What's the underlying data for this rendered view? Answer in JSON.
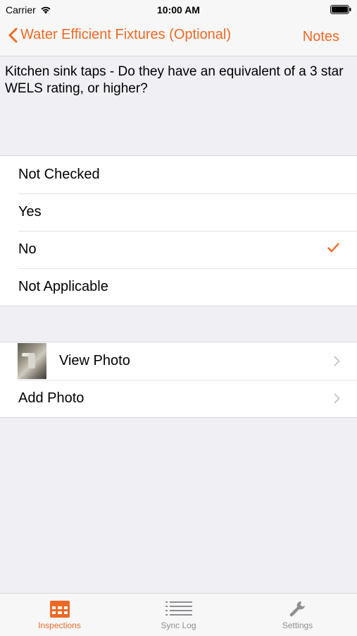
{
  "status_bar": {
    "carrier": "Carrier",
    "time": "10:00 AM"
  },
  "nav": {
    "back_label": "Water Efficient Fixtures (Optional)",
    "notes_label": "Notes"
  },
  "question": "Kitchen sink taps - Do they have an equivalent of a 3 star WELS rating, or higher?",
  "options": [
    {
      "label": "Not Checked",
      "selected": false
    },
    {
      "label": "Yes",
      "selected": false
    },
    {
      "label": "No",
      "selected": true
    },
    {
      "label": "Not Applicable",
      "selected": false
    }
  ],
  "photos": {
    "view_label": "View Photo",
    "add_label": "Add Photo"
  },
  "tabs": [
    {
      "label": "Inspections",
      "icon": "calendar-icon",
      "active": true
    },
    {
      "label": "Sync Log",
      "icon": "list-icon",
      "active": false
    },
    {
      "label": "Settings",
      "icon": "wrench-icon",
      "active": false
    }
  ],
  "colors": {
    "accent": "#ec6a25",
    "background": "#efeff4",
    "inactive": "#8e8e93"
  }
}
